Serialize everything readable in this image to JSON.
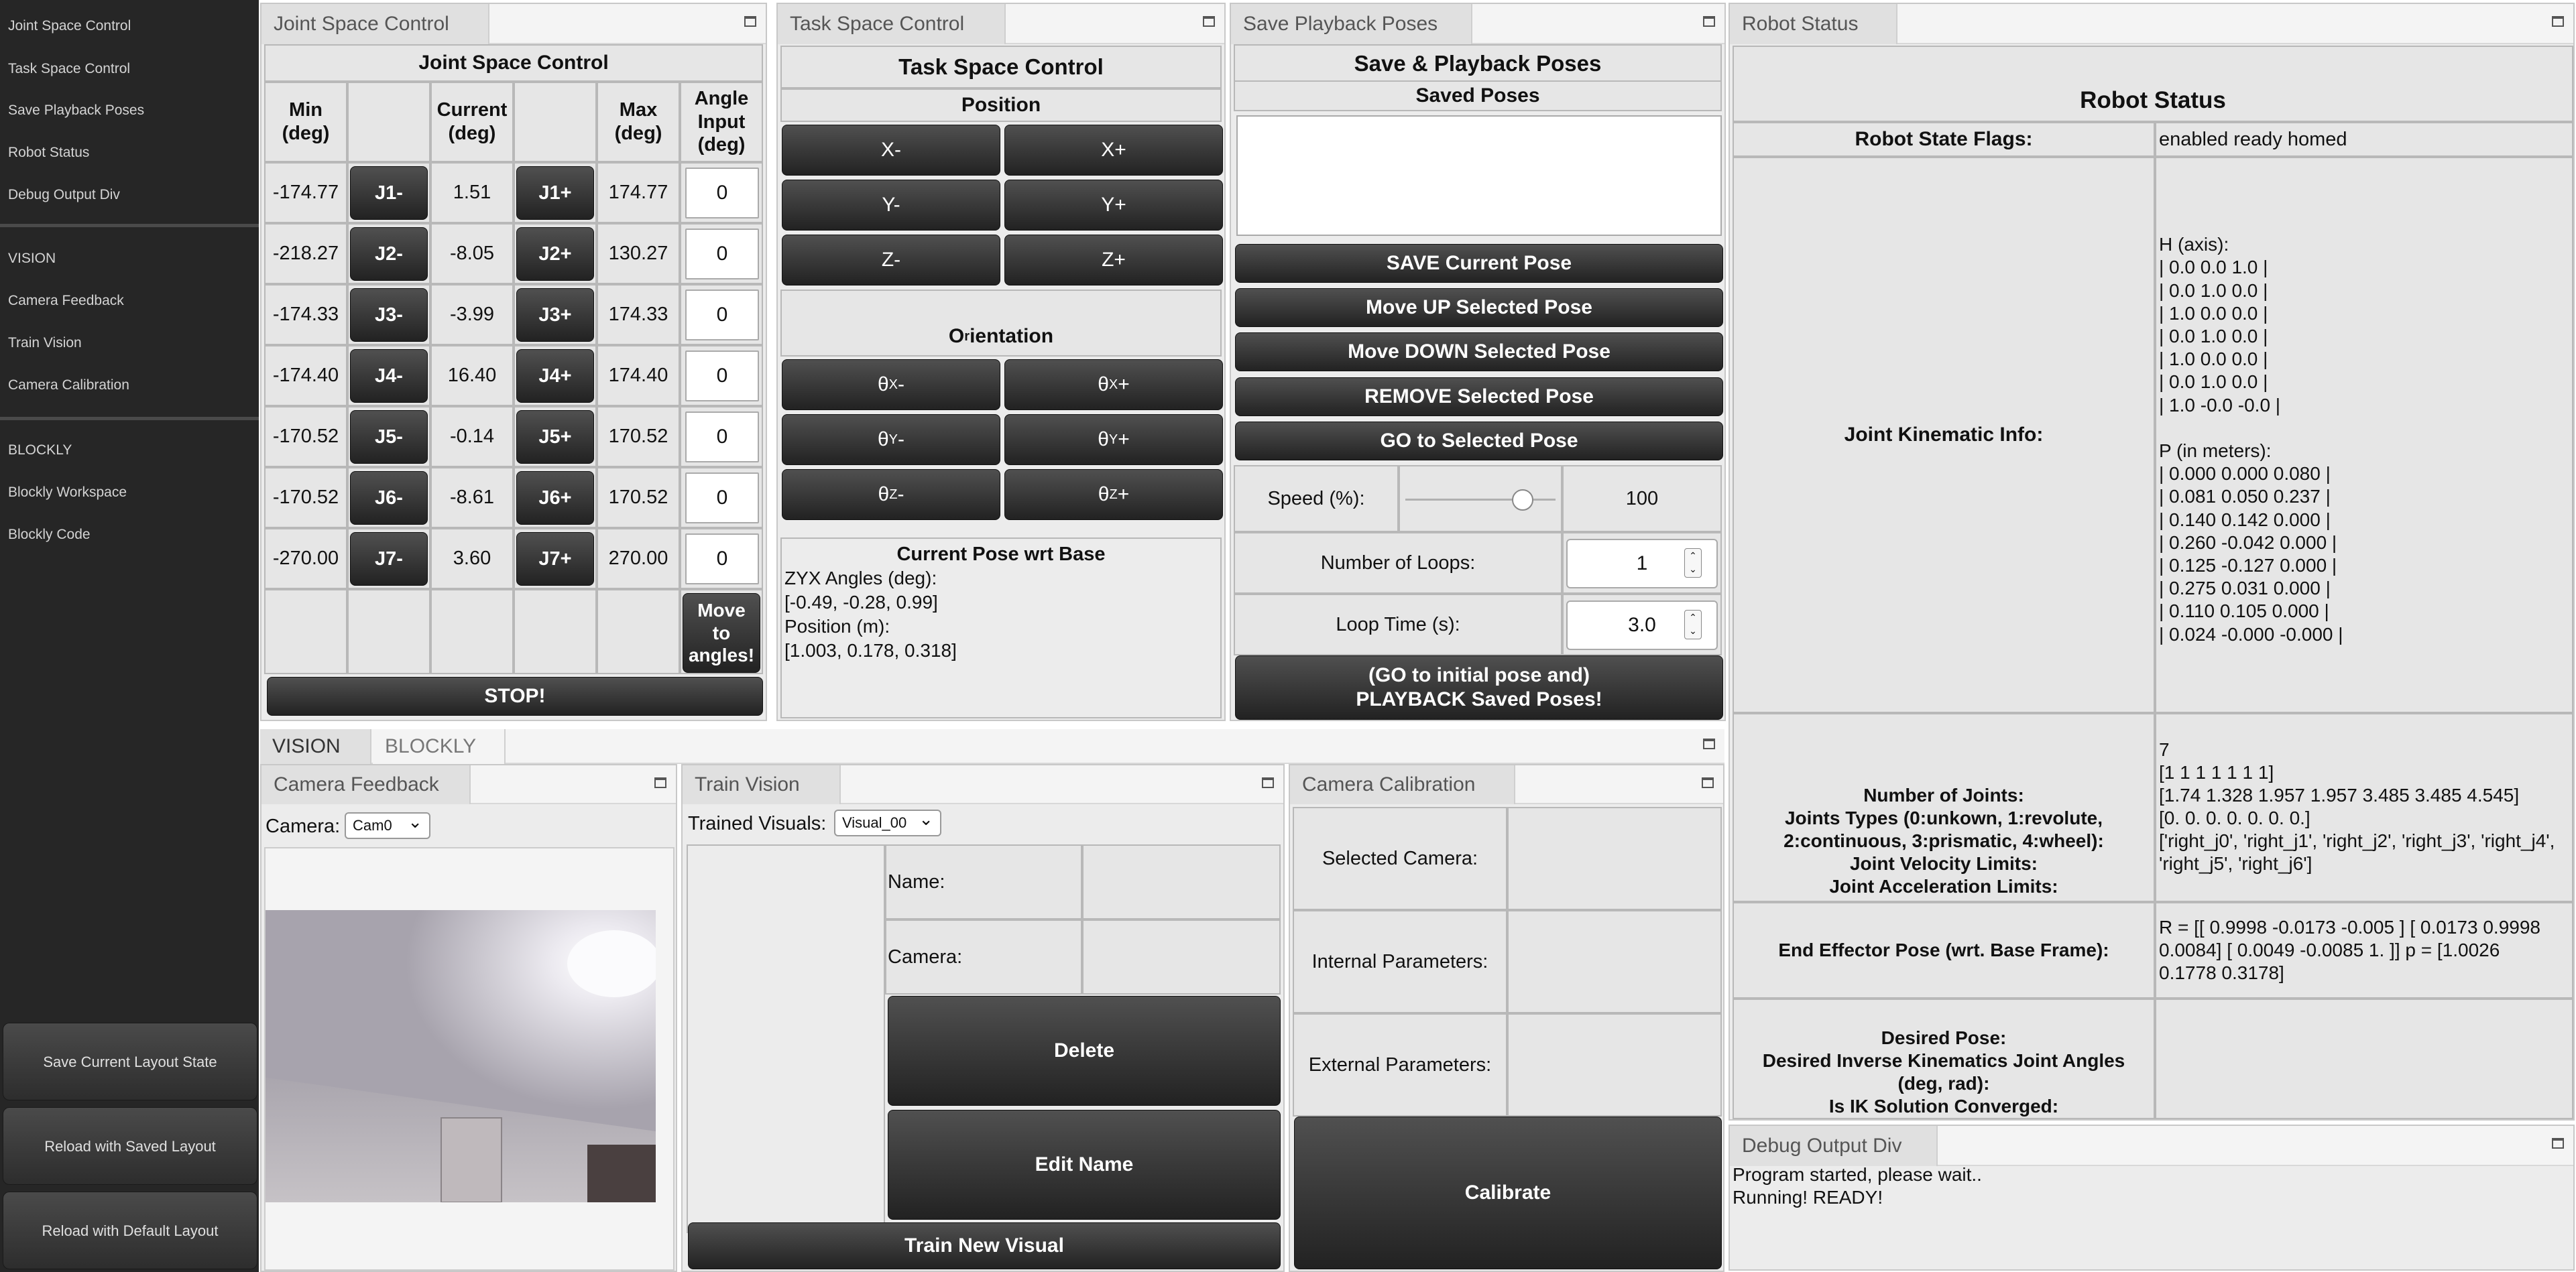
{
  "sidebar": {
    "items": [
      "Joint Space Control",
      "Task Space Control",
      "Save Playback Poses",
      "Robot Status",
      "Debug Output Div"
    ],
    "vision_header": "VISION",
    "vision_items": [
      "Camera Feedback",
      "Train Vision",
      "Camera Calibration"
    ],
    "blockly_header": "BLOCKLY",
    "blockly_items": [
      "Blockly Workspace",
      "Blockly Code"
    ],
    "buttons": [
      "Save Current Layout State",
      "Reload with Saved Layout",
      "Reload with Default Layout"
    ]
  },
  "joint": {
    "tab": "Joint Space Control",
    "title": "Joint Space Control",
    "headers": [
      "Min\n(deg)",
      "",
      "Current\n(deg)",
      "",
      "Max\n(deg)",
      "Angle\nInput\n(deg)"
    ],
    "rows": [
      {
        "min": "-174.77",
        "minus": "J1-",
        "current": "1.51",
        "plus": "J1+",
        "max": "174.77",
        "input": "0"
      },
      {
        "min": "-218.27",
        "minus": "J2-",
        "current": "-8.05",
        "plus": "J2+",
        "max": "130.27",
        "input": "0"
      },
      {
        "min": "-174.33",
        "minus": "J3-",
        "current": "-3.99",
        "plus": "J3+",
        "max": "174.33",
        "input": "0"
      },
      {
        "min": "-174.40",
        "minus": "J4-",
        "current": "16.40",
        "plus": "J4+",
        "max": "174.40",
        "input": "0"
      },
      {
        "min": "-170.52",
        "minus": "J5-",
        "current": "-0.14",
        "plus": "J5+",
        "max": "170.52",
        "input": "0"
      },
      {
        "min": "-170.52",
        "minus": "J6-",
        "current": "-8.61",
        "plus": "J6+",
        "max": "170.52",
        "input": "0"
      },
      {
        "min": "-270.00",
        "minus": "J7-",
        "current": "3.60",
        "plus": "J7+",
        "max": "270.00",
        "input": "0"
      }
    ],
    "move_button": "Move\nto\nangles!",
    "stop_button": "STOP!"
  },
  "task": {
    "tab": "Task Space Control",
    "title": "Task Space Control",
    "position_label": "Position",
    "position_buttons": [
      "X-",
      "X+",
      "Y-",
      "Y+",
      "Z-",
      "Z+"
    ],
    "orientation_label": "Orientation",
    "orientation_buttons": [
      "θX-",
      "θX+",
      "θY-",
      "θY+",
      "θZ-",
      "θZ+"
    ],
    "pose_title": "Current Pose wrt Base",
    "pose_lines": [
      "ZYX Angles (deg):",
      "[-0.49, -0.28, 0.99]",
      "Position (m):",
      "[1.003, 0.178, 0.318]"
    ]
  },
  "playback": {
    "tab": "Save Playback Poses",
    "title": "Save & Playback Poses",
    "saved_label": "Saved Poses",
    "buttons": [
      "SAVE Current Pose",
      "Move UP Selected Pose",
      "Move DOWN Selected Pose",
      "REMOVE Selected Pose",
      "GO to Selected Pose"
    ],
    "speed_label": "Speed (%):",
    "speed_value": "100",
    "speed_fraction": 0.81,
    "loops_label": "Number of Loops:",
    "loops_value": "1",
    "looptime_label": "Loop Time (s):",
    "looptime_value": "3.0",
    "playback_button": "(GO to initial pose and)\nPLAYBACK Saved Poses!"
  },
  "status": {
    "tab": "Robot Status",
    "title": "Robot Status",
    "flags_label": "Robot State Flags:",
    "flags_value": "enabled ready homed",
    "kin_label": "Joint Kinematic Info:",
    "kin_value": "H (axis):\n| 0.0 0.0 1.0 |\n| 0.0 1.0 0.0 |\n| 1.0 0.0 0.0 |\n| 0.0 1.0 0.0 |\n| 1.0 0.0 0.0 |\n| 0.0 1.0 0.0 |\n| 1.0 -0.0 -0.0 |\n\nP (in meters):\n| 0.000 0.000 0.080 |\n| 0.081 0.050 0.237 |\n| 0.140 0.142 0.000 |\n| 0.260 -0.042 0.000 |\n| 0.125 -0.127 0.000 |\n| 0.275 0.031 0.000 |\n| 0.110 0.105 0.000 |\n| 0.024 -0.000 -0.000 |",
    "joints_label": "Number of Joints:\nJoints Types (0:unkown, 1:revolute,\n2:continuous, 3:prismatic, 4:wheel):\nJoint Velocity Limits:\nJoint Acceleration Limits:",
    "joints_value": "7\n[1 1 1 1 1 1 1]\n[1.74 1.328 1.957 1.957 3.485 3.485 4.545]\n[0. 0. 0. 0. 0. 0. 0.]\n['right_j0', 'right_j1', 'right_j2', 'right_j3', 'right_j4',\n'right_j5', 'right_j6']",
    "ee_label": "End Effector Pose (wrt. Base Frame):",
    "ee_value": "R = [[ 0.9998 -0.0173 -0.005 ] [ 0.0173 0.9998\n0.0084] [ 0.0049 -0.0085 1. ]] p = [1.0026\n0.1778 0.3178]",
    "desired_label": "Desired Pose:\nDesired Inverse Kinematics Joint Angles\n(deg, rad):\nIs IK Solution Converged:",
    "desired_value": ""
  },
  "bottom_tabs": [
    "VISION",
    "BLOCKLY"
  ],
  "camera": {
    "tab": "Camera Feedback",
    "label": "Camera:",
    "selected": "Cam0"
  },
  "train": {
    "tab": "Train Vision",
    "label": "Trained Visuals:",
    "selected": "Visual_00",
    "name_label": "Name:",
    "camera_label": "Camera:",
    "delete_button": "Delete",
    "edit_button": "Edit Name",
    "train_button": "Train New Visual"
  },
  "calib": {
    "tab": "Camera Calibration",
    "labels": [
      "Selected Camera:",
      "Internal Parameters:",
      "External Parameters:"
    ],
    "button": "Calibrate"
  },
  "debug": {
    "tab": "Debug Output Div",
    "lines": [
      "Program started, please wait..",
      "Running! READY!"
    ]
  }
}
